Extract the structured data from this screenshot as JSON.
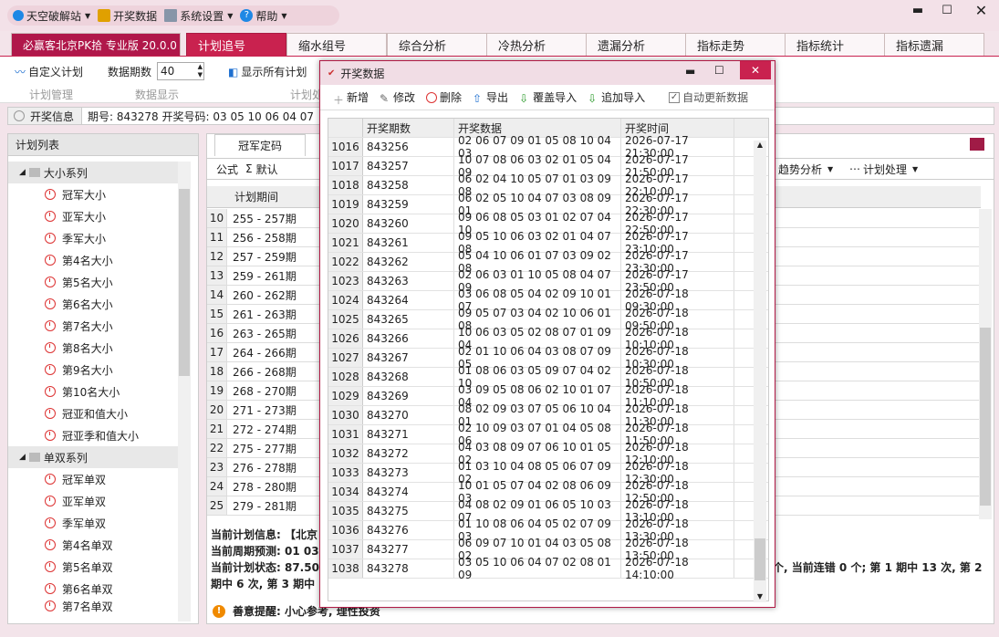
{
  "menu": {
    "items": [
      {
        "label": "天空破解站"
      },
      {
        "label": "开奖数据"
      },
      {
        "label": "系统设置"
      },
      {
        "label": "帮助"
      }
    ]
  },
  "tabs": {
    "app_name": "必赢客北京PK拾 专业版 20.0.0",
    "items": [
      "计划追号",
      "缩水组号",
      "综合分析",
      "冷热分析",
      "遗漏分析",
      "指标走势",
      "指标统计",
      "指标遗漏"
    ]
  },
  "toolbar": {
    "custom_plan": "自定义计划",
    "periods_label": "数据期数",
    "periods_value": "40",
    "show_all": "显示所有计划",
    "grp_plan": "计划管理",
    "grp_display": "数据显示",
    "grp_partial": "计划处"
  },
  "info": {
    "label": "开奖信息",
    "text": "期号: 843278    开奖号码: 03 05 10 06 04 07"
  },
  "left": {
    "header": "计划列表",
    "groups": [
      {
        "label": "大小系列",
        "items": [
          "冠军大小",
          "亚军大小",
          "季军大小",
          "第4名大小",
          "第5名大小",
          "第6名大小",
          "第7名大小",
          "第8名大小",
          "第9名大小",
          "第10名大小",
          "冠亚和值大小",
          "冠亚季和值大小"
        ]
      },
      {
        "label": "单双系列",
        "items": [
          "冠军单双",
          "亚军单双",
          "季军单双",
          "第4名单双",
          "第5名单双",
          "第6名单双",
          "第7名单双"
        ]
      }
    ]
  },
  "center": {
    "tab": "冠军定码",
    "formula_label": "公式",
    "formula_value": "默认",
    "col_period": "计划期间",
    "trend": "趋势分析",
    "process": "计划处理",
    "rows": [
      [
        "10",
        "255 - 257期"
      ],
      [
        "11",
        "256 - 258期"
      ],
      [
        "12",
        "257 - 259期"
      ],
      [
        "13",
        "259 - 261期"
      ],
      [
        "14",
        "260 - 262期"
      ],
      [
        "15",
        "261 - 263期"
      ],
      [
        "16",
        "263 - 265期"
      ],
      [
        "17",
        "264 - 266期"
      ],
      [
        "18",
        "266 - 268期"
      ],
      [
        "19",
        "268 - 270期"
      ],
      [
        "20",
        "271 - 273期"
      ],
      [
        "21",
        "272 - 274期"
      ],
      [
        "22",
        "275 - 277期"
      ],
      [
        "23",
        "276 - 278期"
      ],
      [
        "24",
        "278 - 280期"
      ],
      [
        "25",
        "279 - 281期"
      ]
    ],
    "info1": "当前计划信息:  【北京",
    "info2": "当前周期预测:  01 03",
    "info3": "当前计划状态:  87.50",
    "info3_right": "个, 当前连错 0 个; 第 1 期中 13 次, 第 2",
    "info4": "期中 6 次, 第 3 期中",
    "warn": "善意提醒: 小心参考, 理性投资"
  },
  "dialog": {
    "title": "开奖数据",
    "buttons": [
      "新增",
      "修改",
      "删除",
      "导出",
      "覆盖导入",
      "追加导入"
    ],
    "auto_update": "自动更新数据",
    "headers": [
      "开奖期数",
      "开奖数据",
      "开奖时间"
    ],
    "rows": [
      [
        "1016",
        "843256",
        "02 06 07 09 01 05 08 10 04 03",
        "2026-07-17 21:30:00"
      ],
      [
        "1017",
        "843257",
        "10 07 08 06 03 02 01 05 04 09",
        "2026-07-17 21:50:00"
      ],
      [
        "1018",
        "843258",
        "06 02 04 10 05 07 01 03 09 08",
        "2026-07-17 22:10:00"
      ],
      [
        "1019",
        "843259",
        "06 02 05 10 04 07 03 08 09 01",
        "2026-07-17 22:30:00"
      ],
      [
        "1020",
        "843260",
        "09 06 08 05 03 01 02 07 04 10",
        "2026-07-17 22:50:00"
      ],
      [
        "1021",
        "843261",
        "09 05 10 06 03 02 01 04 07 08",
        "2026-07-17 23:10:00"
      ],
      [
        "1022",
        "843262",
        "05 04 10 06 01 07 03 09 02 08",
        "2026-07-17 23:30:00"
      ],
      [
        "1023",
        "843263",
        "02 06 03 01 10 05 08 04 07 09",
        "2026-07-17 23:50:00"
      ],
      [
        "1024",
        "843264",
        "03 06 08 05 04 02 09 10 01 07",
        "2026-07-18 09:30:00"
      ],
      [
        "1025",
        "843265",
        "09 05 07 03 04 02 10 06 01 08",
        "2026-07-18 09:50:00"
      ],
      [
        "1026",
        "843266",
        "10 06 03 05 02 08 07 01 09 04",
        "2026-07-18 10:10:00"
      ],
      [
        "1027",
        "843267",
        "02 01 10 06 04 03 08 07 09 05",
        "2026-07-18 10:30:00"
      ],
      [
        "1028",
        "843268",
        "01 08 06 03 05 09 07 04 02 10",
        "2026-07-18 10:50:00"
      ],
      [
        "1029",
        "843269",
        "03 09 05 08 06 02 10 01 07 04",
        "2026-07-18 11:10:00"
      ],
      [
        "1030",
        "843270",
        "08 02 09 03 07 05 06 10 04 01",
        "2026-07-18 11:30:00"
      ],
      [
        "1031",
        "843271",
        "02 10 09 03 07 01 04 05 08 06",
        "2026-07-18 11:50:00"
      ],
      [
        "1032",
        "843272",
        "04 03 08 09 07 06 10 01 05 02",
        "2026-07-18 12:10:00"
      ],
      [
        "1033",
        "843273",
        "01 03 10 04 08 05 06 07 09 02",
        "2026-07-18 12:30:00"
      ],
      [
        "1034",
        "843274",
        "10 01 05 07 04 02 08 06 09 03",
        "2026-07-18 12:50:00"
      ],
      [
        "1035",
        "843275",
        "04 08 02 09 01 06 05 10 03 07",
        "2026-07-18 13:10:00"
      ],
      [
        "1036",
        "843276",
        "01 10 08 06 04 05 02 07 09 03",
        "2026-07-18 13:30:00"
      ],
      [
        "1037",
        "843277",
        "06 09 07 10 01 04 03 05 08 02",
        "2026-07-18 13:50:00"
      ],
      [
        "1038",
        "843278",
        "03 05 10 06 04 07 02 08 01 09",
        "2026-07-18 14:10:00"
      ]
    ]
  },
  "colors": {
    "accent": "#c9224f",
    "titlebar": "#f3e1e8"
  }
}
